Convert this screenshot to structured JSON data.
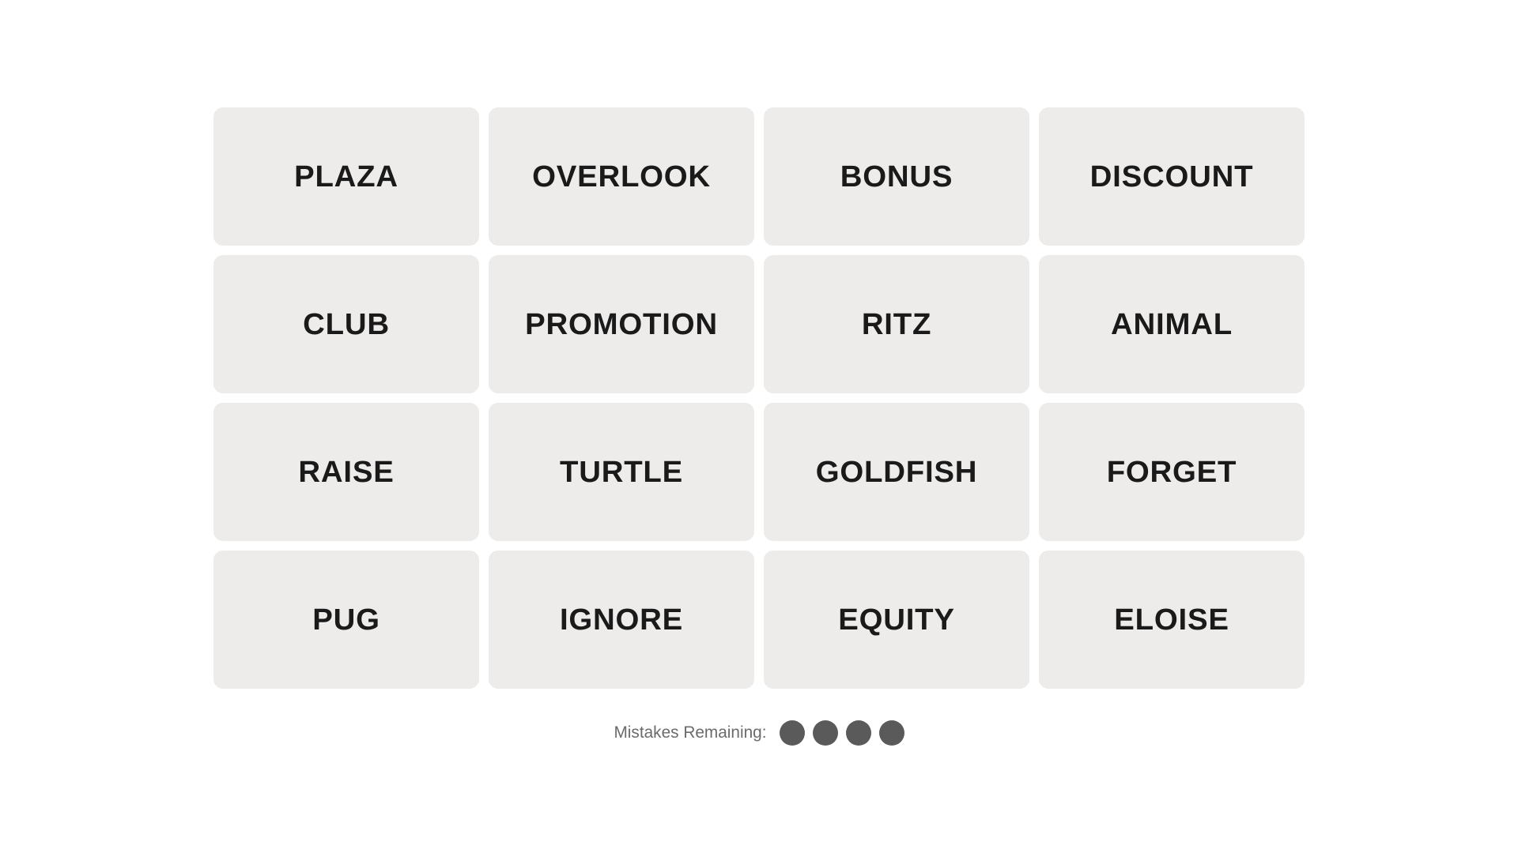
{
  "grid": {
    "words": [
      {
        "id": "plaza",
        "label": "PLAZA"
      },
      {
        "id": "overlook",
        "label": "OVERLOOK"
      },
      {
        "id": "bonus",
        "label": "BONUS"
      },
      {
        "id": "discount",
        "label": "DISCOUNT"
      },
      {
        "id": "club",
        "label": "CLUB"
      },
      {
        "id": "promotion",
        "label": "PROMOTION"
      },
      {
        "id": "ritz",
        "label": "RITZ"
      },
      {
        "id": "animal",
        "label": "ANIMAL"
      },
      {
        "id": "raise",
        "label": "RAISE"
      },
      {
        "id": "turtle",
        "label": "TURTLE"
      },
      {
        "id": "goldfish",
        "label": "GOLDFISH"
      },
      {
        "id": "forget",
        "label": "FORGET"
      },
      {
        "id": "pug",
        "label": "PUG"
      },
      {
        "id": "ignore",
        "label": "IGNORE"
      },
      {
        "id": "equity",
        "label": "EQUITY"
      },
      {
        "id": "eloise",
        "label": "ELOISE"
      }
    ]
  },
  "footer": {
    "mistakes_label": "Mistakes Remaining:",
    "dots_count": 4
  }
}
